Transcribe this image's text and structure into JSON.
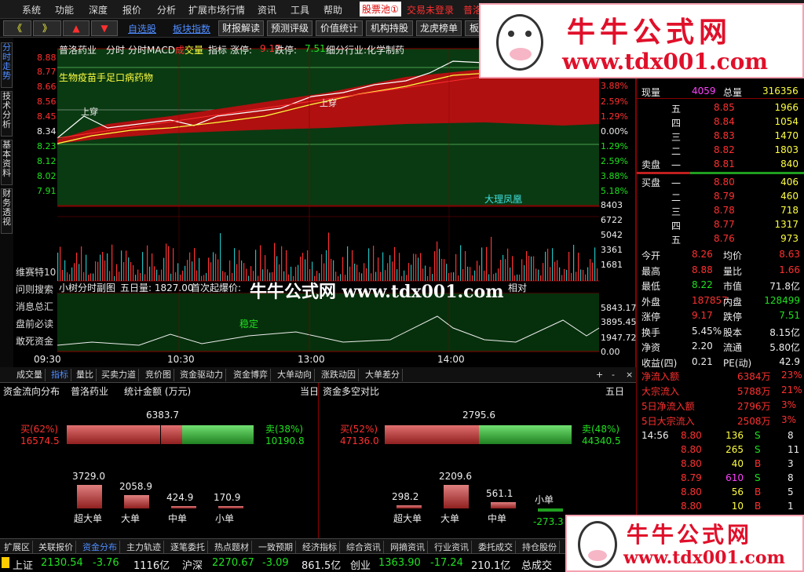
{
  "menu": {
    "items": [
      "系统",
      "功能",
      "深度",
      "报价",
      "分析",
      "扩展市场行情",
      "资讯",
      "工具",
      "帮助"
    ],
    "pool": "股票池",
    "pool_count": "①",
    "trade": "交易未登录",
    "extra": "普洛"
  },
  "toolbar": {
    "btn_prev": "《",
    "btn_next": "》",
    "btn_up": "▲",
    "btn_down": "▼",
    "links": [
      "自选股",
      "板块指数"
    ],
    "buttons": [
      "财报解读",
      "预测评级",
      "价值统计",
      "机构持股",
      "龙虎榜单",
      "板"
    ]
  },
  "left_tabs": [
    "分时走势",
    "技术分析",
    "基本资料",
    "财务透视"
  ],
  "chart": {
    "stock_name": "普洛药业",
    "mode_labels": [
      "分时",
      "分时MACD"
    ],
    "vol_label_a": "成",
    "vol_label_b": "交量",
    "indicator": "指标",
    "limit_up_label": "涨停:",
    "limit_up": "9.17",
    "limit_down_label": "跌停:",
    "limit_down": "7.51",
    "industry": "细分行业:化学制药",
    "concept": "生物疫苗手足口病药物",
    "price_ticks": [
      "8.88",
      "8.77",
      "8.66",
      "8.56",
      "8.45",
      "8.34",
      "8.23",
      "8.12",
      "8.02",
      "7.91"
    ],
    "pct_ticks": [
      "3.88%",
      "2.59%",
      "1.29%",
      "0.00%",
      "1.29%",
      "2.59%",
      "3.88%",
      "5.18%"
    ],
    "vol_ticks": [
      "8403",
      "6722",
      "5042",
      "3361",
      "1681"
    ],
    "vol_tag": "大理凤凰",
    "sub_title": "小树分时副图",
    "sub_vol": "五日量: 1827.00",
    "sub_first": "首次起爆价:",
    "sub_ticks": [
      "5843.17",
      "3895.45",
      "1947.72",
      "0.00"
    ],
    "sub_label": "稳定",
    "time_ticks": [
      "09:30",
      "10:30",
      "13:00",
      "14:00"
    ],
    "signal": "上穿",
    "sub_tag": "相对"
  },
  "side_list": [
    "维赛特10",
    "问则搜索",
    "消息总汇",
    "盘前必读",
    "敢死资金"
  ],
  "panel": {
    "tabs": [
      "成交量",
      "指标",
      "量比",
      "买卖力道",
      "竞价图",
      "资金驱动力",
      "资金博弈",
      "大单动向",
      "涨跌动因",
      "大单差分"
    ],
    "left_title": "资金流向分布",
    "left_stock": "普洛药业",
    "left_unit": "统计金额 (万元)",
    "left_period": "当日",
    "left_total": "6383.7",
    "left_buy_label": "买(62%)",
    "left_buy": "16574.5",
    "left_sell_label": "卖(38%)",
    "left_sell": "10190.8",
    "left_bars": [
      {
        "label": "超大单",
        "value": "3729.0"
      },
      {
        "label": "大单",
        "value": "2058.9"
      },
      {
        "label": "中单",
        "value": "424.9"
      },
      {
        "label": "小单",
        "value": "170.9"
      }
    ],
    "right_title": "资金多空对比",
    "right_period": "五日",
    "right_total": "2795.6",
    "right_buy_label": "买(52%)",
    "right_buy": "47136.0",
    "right_sell_label": "卖(48%)",
    "right_sell": "44340.5",
    "right_bars": [
      {
        "label": "超大单",
        "value": "298.2"
      },
      {
        "label": "大单",
        "value": "2209.6"
      },
      {
        "label": "中单",
        "value": "561.1"
      },
      {
        "label": "小单",
        "value": "-273.3"
      }
    ]
  },
  "quote": {
    "cur_vol_label": "现量",
    "cur_vol": "4059",
    "total_label": "总量",
    "total": "316356",
    "sell": [
      {
        "lvl": "五",
        "p": "8.85",
        "v": "1966"
      },
      {
        "lvl": "四",
        "p": "8.84",
        "v": "1054"
      },
      {
        "lvl": "三",
        "p": "8.83",
        "v": "1470"
      },
      {
        "lvl": "二",
        "p": "8.82",
        "v": "1803"
      },
      {
        "lvl": "一",
        "p": "8.81",
        "v": "840"
      }
    ],
    "sell_label": "卖盘",
    "buy_label": "买盘",
    "buy": [
      {
        "lvl": "一",
        "p": "8.80",
        "v": "406"
      },
      {
        "lvl": "二",
        "p": "8.79",
        "v": "460"
      },
      {
        "lvl": "三",
        "p": "8.78",
        "v": "718"
      },
      {
        "lvl": "四",
        "p": "8.77",
        "v": "1317"
      },
      {
        "lvl": "五",
        "p": "8.76",
        "v": "973"
      }
    ],
    "stats": [
      [
        "今开",
        "8.26",
        "均价",
        "8.63"
      ],
      [
        "最高",
        "8.88",
        "量比",
        "1.66"
      ],
      [
        "最低",
        "8.22",
        "市值",
        "71.8亿"
      ],
      [
        "外盘",
        "187857",
        "内盘",
        "128499"
      ],
      [
        "涨停",
        "9.17",
        "跌停",
        "7.51"
      ],
      [
        "换手",
        "5.45%",
        "股本",
        "8.15亿"
      ],
      [
        "净资",
        "2.20",
        "流通",
        "5.80亿"
      ],
      [
        "收益(四)",
        "0.21",
        "PE(动)",
        "42.9"
      ]
    ],
    "flows": [
      [
        "净流入额",
        "6384万",
        "23%"
      ],
      [
        "大宗流入",
        "5788万",
        "21%"
      ],
      [
        "5日净流入额",
        "2796万",
        "3%"
      ],
      [
        "5日大宗流入",
        "2508万",
        "3%"
      ]
    ],
    "ticks": [
      [
        "14:56",
        "8.80",
        "136",
        "S",
        "8"
      ],
      [
        "",
        "8.80",
        "265",
        "S",
        "11"
      ],
      [
        "",
        "8.80",
        "40",
        "B",
        "3"
      ],
      [
        "",
        "8.79",
        "610",
        "S",
        "8"
      ],
      [
        "",
        "8.80",
        "56",
        "B",
        "5"
      ],
      [
        "",
        "8.80",
        "10",
        "B",
        "1"
      ]
    ]
  },
  "bottom_tabs": [
    "扩展区",
    "关联报价",
    "资金分布",
    "主力轨迹",
    "逐笔委托",
    "热点题材",
    "一致预期",
    "经济指标",
    "综合资讯",
    "网摘资讯",
    "行业资讯",
    "委托成交",
    "持仓股份"
  ],
  "status": {
    "sh_label": "上证",
    "sh": "2130.54",
    "sh_chg": "-3.76",
    "sh_amt": "1116亿",
    "hs_label": "沪深",
    "hs": "2270.67",
    "hs_chg": "-3.09",
    "hs_amt": "861.5亿",
    "cy_label": "创业",
    "cy": "1363.90",
    "cy_chg": "-17.24",
    "cy_amt": "210.1亿",
    "tail": "总成交"
  },
  "watermark": {
    "title": "牛牛公式网",
    "url": "www.tdx001.com",
    "overlay": "牛牛公式网 www.tdx001.com"
  }
}
